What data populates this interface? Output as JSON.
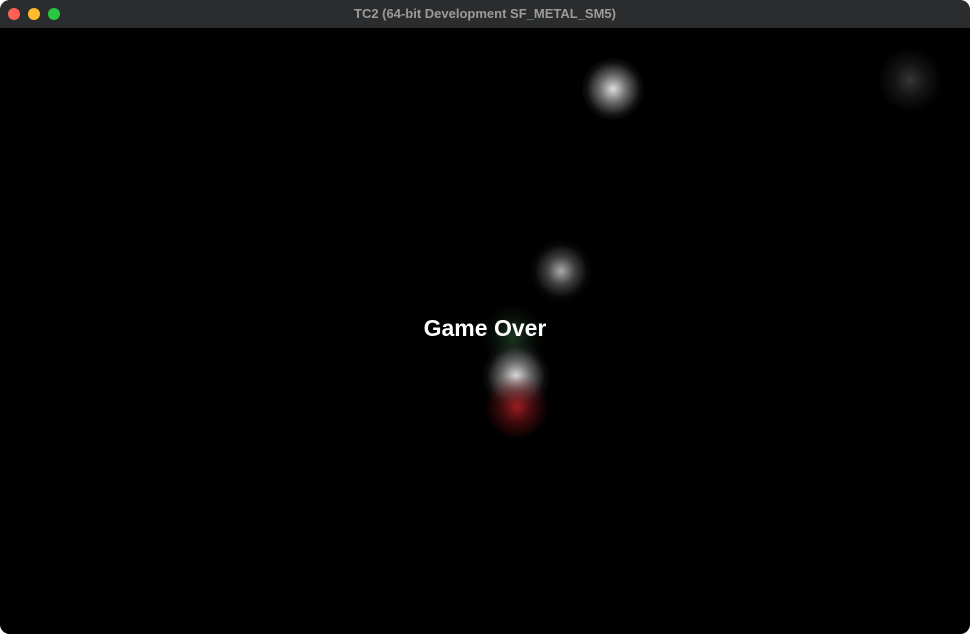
{
  "window": {
    "title": "TC2 (64-bit Development SF_METAL_SM5)",
    "controls": {
      "close_color": "#fe5f57",
      "minimize_color": "#febc2e",
      "zoom_color": "#28c840"
    }
  },
  "game": {
    "message": "Game Over",
    "background_color": "#000000",
    "orbs": [
      {
        "name": "white-orb",
        "color": "#e6e6e6"
      },
      {
        "name": "dim-orb",
        "color": "#3c3c3c"
      },
      {
        "name": "white-orb",
        "color": "#bebebe"
      },
      {
        "name": "green-orb",
        "color": "#3c7846"
      },
      {
        "name": "white-orb",
        "color": "#e6e6e6"
      },
      {
        "name": "red-orb",
        "color": "#aa1e23"
      }
    ]
  }
}
